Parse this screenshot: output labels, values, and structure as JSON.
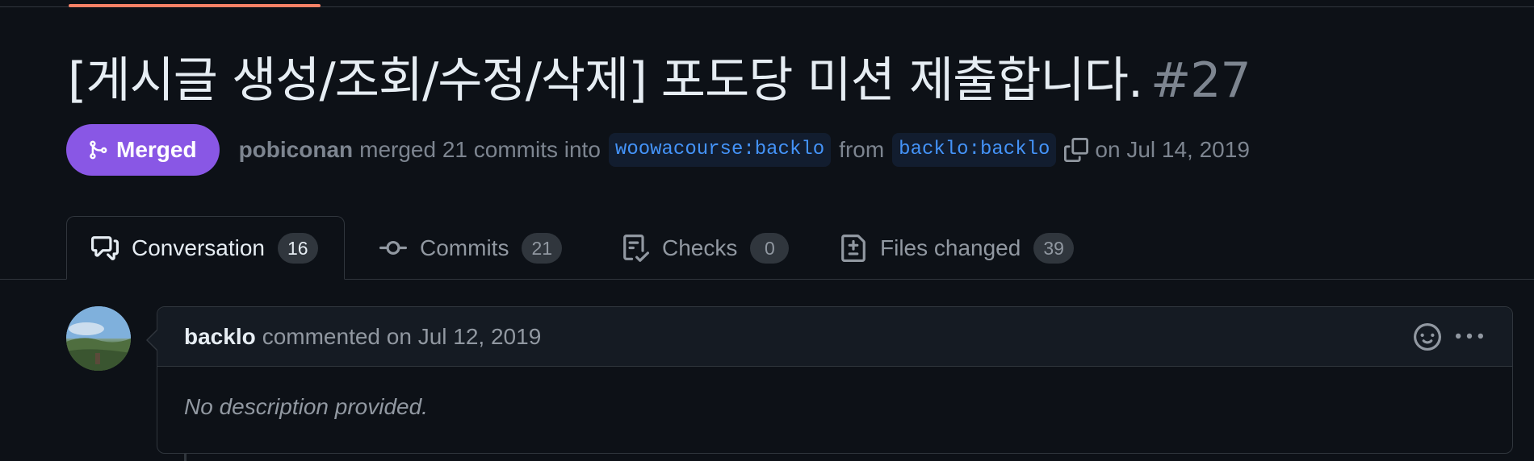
{
  "pr": {
    "title": "[게시글 생성/조회/수정/삭제] 포도당 미션 제출합니다.",
    "number": "#27",
    "status": "Merged",
    "author": "pobiconan",
    "merge_text": "merged 21 commits into",
    "base_branch": "woowacourse:backlo",
    "from_text": "from",
    "head_branch": "backlo:backlo",
    "date_text": "on Jul 14, 2019"
  },
  "tabs": [
    {
      "label": "Conversation",
      "count": "16",
      "icon": "comment-discussion-icon"
    },
    {
      "label": "Commits",
      "count": "21",
      "icon": "git-commit-icon"
    },
    {
      "label": "Checks",
      "count": "0",
      "icon": "checklist-icon"
    },
    {
      "label": "Files changed",
      "count": "39",
      "icon": "file-diff-icon"
    }
  ],
  "comment": {
    "author": "backlo",
    "meta": "commented on Jul 12, 2019",
    "body": "No description provided."
  },
  "colors": {
    "background": "#0d1117",
    "merged": "#8957e5",
    "link": "#4493f8",
    "border": "#30363d",
    "accent": "#f78166"
  }
}
